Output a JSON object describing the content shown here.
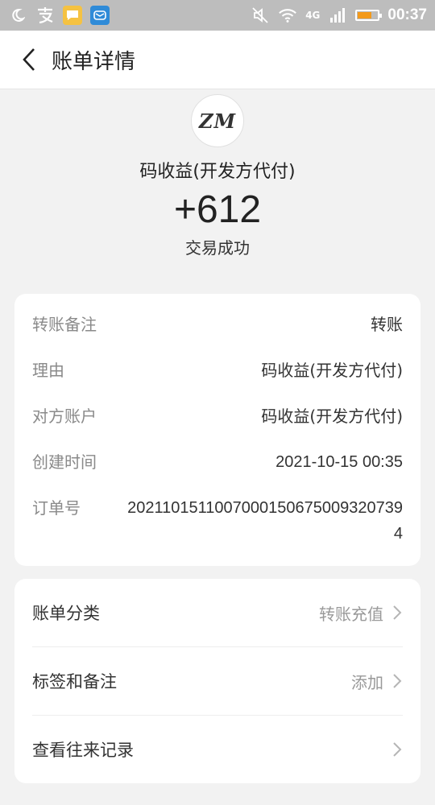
{
  "status_bar": {
    "network": "4G",
    "time": "00:37",
    "icons": [
      "moon-icon",
      "alipay-icon",
      "chat-app-icon",
      "message-app-icon",
      "mute-icon",
      "wifi-icon",
      "signal-icon",
      "battery-icon"
    ],
    "battery_level_percent": 70,
    "battery_color": "#f39a1b"
  },
  "header": {
    "title": "账单详情",
    "back_icon": "chevron-left-icon"
  },
  "summary": {
    "avatar_text": "ZM",
    "payee": "码收益(开发方代付)",
    "amount": "+612",
    "status": "交易成功"
  },
  "details": [
    {
      "label": "转账备注",
      "value": "转账"
    },
    {
      "label": "理由",
      "value": "码收益(开发方代付)"
    },
    {
      "label": "对方账户",
      "value": "码收益(开发方代付)"
    },
    {
      "label": "创建时间",
      "value": "2021-10-15 00:35"
    },
    {
      "label": "订单号",
      "value": "20211015110070001506750093207394"
    }
  ],
  "actions": [
    {
      "label": "账单分类",
      "value": "转账充值"
    },
    {
      "label": "标签和备注",
      "value": "添加"
    },
    {
      "label": "查看往来记录",
      "value": ""
    }
  ],
  "colors": {
    "background": "#f2f2f2",
    "status_bar": "#bdbdbd",
    "card": "#ffffff",
    "label_gray": "#8a8a8a"
  }
}
